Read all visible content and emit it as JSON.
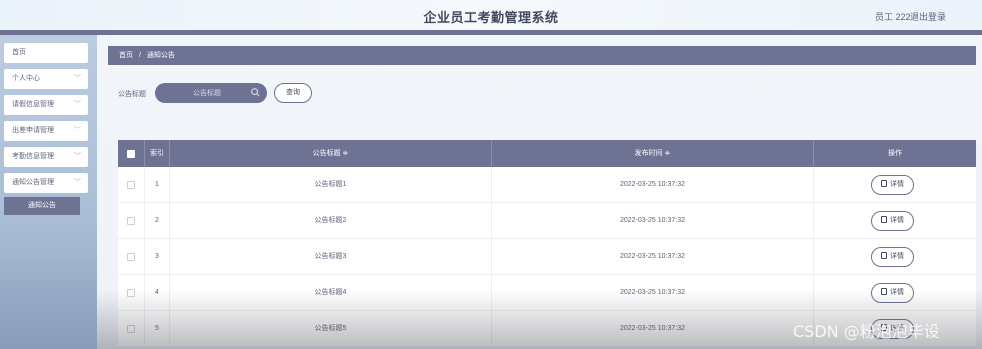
{
  "header": {
    "title": "企业员工考勤管理系统",
    "user_label": "员工 222",
    "logout_label": "退出登录"
  },
  "sidebar": {
    "items": [
      {
        "label": "首页",
        "has_chevron": false
      },
      {
        "label": "个人中心",
        "has_chevron": true
      },
      {
        "label": "请假信息管理",
        "has_chevron": true
      },
      {
        "label": "出差申请管理",
        "has_chevron": true
      },
      {
        "label": "考勤信息管理",
        "has_chevron": true
      },
      {
        "label": "通知公告管理",
        "has_chevron": true
      }
    ],
    "active_subitem": "通知公告"
  },
  "breadcrumb": {
    "home": "首页",
    "separator": "/",
    "current": "通知公告"
  },
  "search": {
    "label": "公告标题",
    "placeholder": "公告标题",
    "button_label": "查询"
  },
  "table": {
    "columns": [
      "索引",
      "公告标题 ≑",
      "发布时间 ≑",
      "操作"
    ],
    "detail_label": "详情",
    "rows": [
      {
        "index": "1",
        "title": "公告标题1",
        "time": "2022-03-25 10:37:32"
      },
      {
        "index": "2",
        "title": "公告标题2",
        "time": "2022-03-25 10:37:32"
      },
      {
        "index": "3",
        "title": "公告标题3",
        "time": "2022-03-25 10:37:32"
      },
      {
        "index": "4",
        "title": "公告标题4",
        "time": "2022-03-25 10:37:32"
      },
      {
        "index": "5",
        "title": "公告标题5",
        "time": "2022-03-25 10:37:32"
      }
    ]
  },
  "watermark": "CSDN @粉泡泡毕设",
  "colors": {
    "accent": "#6e7394",
    "sidebar_bg": "#b3c4dc",
    "page_bg": "#eef3f8"
  }
}
